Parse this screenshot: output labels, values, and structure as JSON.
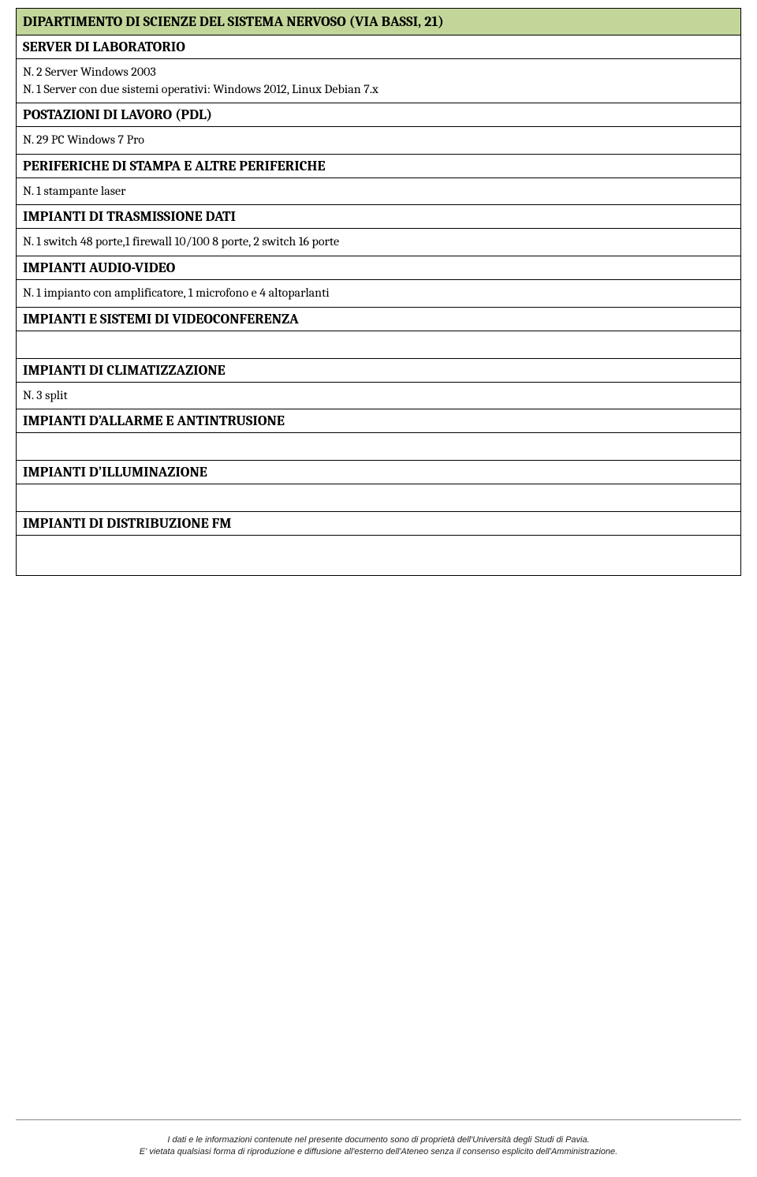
{
  "title": "DIPARTIMENTO DI SCIENZE DEL SISTEMA NERVOSO (VIA BASSI, 21)",
  "sections": {
    "server_lab": {
      "header": "SERVER DI LABORATORIO",
      "line1": "N. 2 Server Windows 2003",
      "line2": "N. 1 Server con due sistemi operativi:  Windows 2012, Linux Debian 7.x"
    },
    "pdl": {
      "header": "POSTAZIONI DI LAVORO (PDL)",
      "line1": "N. 29 PC Windows 7 Pro"
    },
    "periferiche": {
      "header": "PERIFERICHE DI STAMPA E ALTRE PERIFERICHE",
      "line1": "N. 1 stampante laser"
    },
    "trasmissione": {
      "header": "IMPIANTI DI TRASMISSIONE DATI",
      "line1": "N. 1 switch 48 porte,1 firewall 10/100 8 porte, 2 switch 16 porte"
    },
    "audiovideo": {
      "header": "IMPIANTI AUDIO-VIDEO",
      "line1": "N. 1 impianto con amplificatore, 1 microfono e 4 altoparlanti"
    },
    "videoconf": {
      "header": "IMPIANTI E SISTEMI DI VIDEOCONFERENZA"
    },
    "clima": {
      "header": "IMPIANTI DI CLIMATIZZAZIONE",
      "line1": "N.  3 split"
    },
    "allarme": {
      "header": "IMPIANTI D’ALLARME E ANTINTRUSIONE"
    },
    "illuminazione": {
      "header": "IMPIANTI D’ILLUMINAZIONE"
    },
    "fm": {
      "header": "IMPIANTI DI DISTRIBUZIONE FM"
    }
  },
  "footer": {
    "line1": "I dati e le informazioni contenute nel presente documento sono di proprietà dell'Università degli Studi di Pavia.",
    "line2": "E' vietata qualsiasi forma di riproduzione e diffusione all'esterno dell'Ateneo senza il consenso esplicito dell'Amministrazione."
  }
}
